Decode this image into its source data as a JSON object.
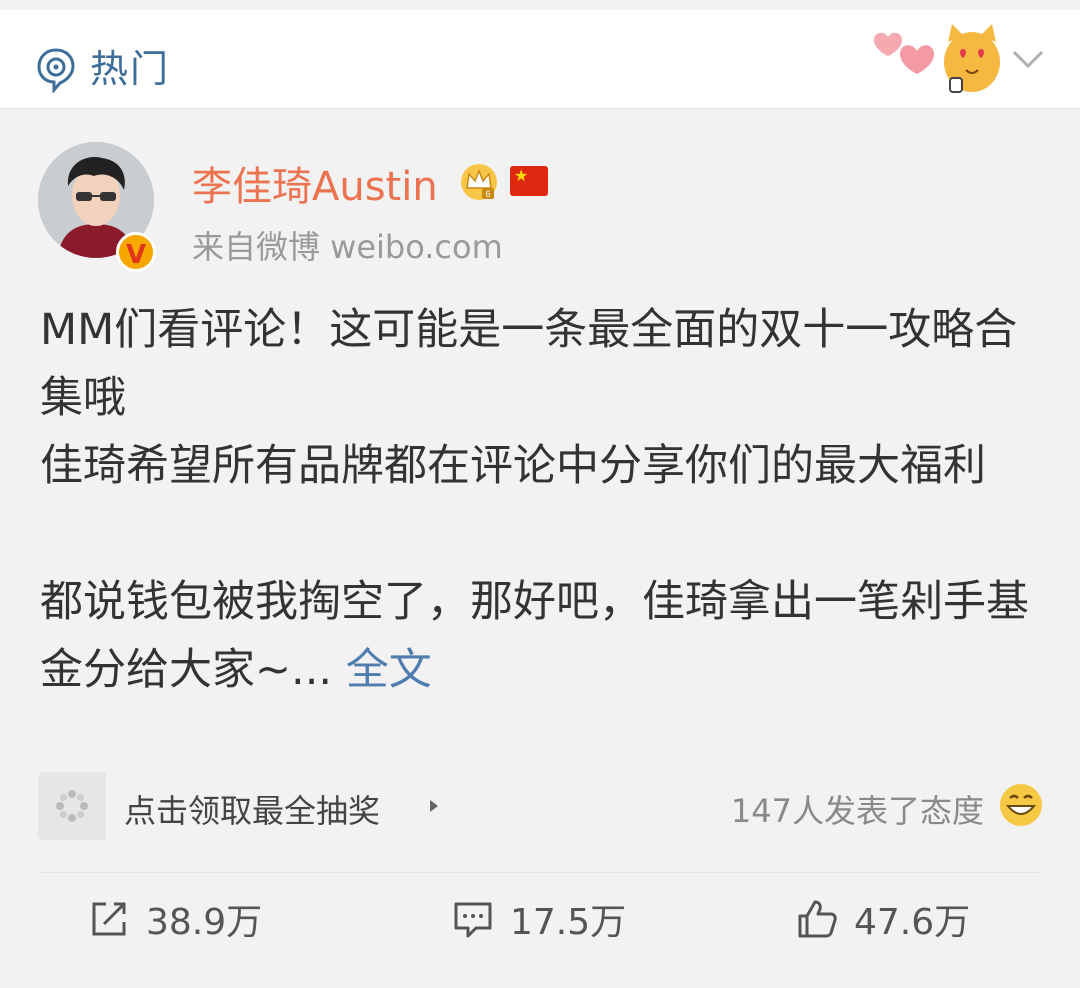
{
  "header": {
    "section_label": "热门"
  },
  "post": {
    "username": "李佳琦Austin",
    "source": "来自微博 weibo.com",
    "verified_badge": "V",
    "body": {
      "line1": "MM们看评论！这可能是一条最全面的双十一攻略合集哦",
      "line2": "佳琦希望所有品牌都在评论中分享你们的最大福利",
      "line3": "都说钱包被我掏空了，那好吧，佳琦拿出一笔剁手基金分给大家~... ",
      "more_link": "全文"
    },
    "lottery_label": "点击领取最全抽奖",
    "attitude_text": "147人发表了态度",
    "actions": {
      "repost_count": "38.9万",
      "comment_count": "17.5万",
      "like_count": "47.6万"
    }
  },
  "colors": {
    "username": "#eb7350",
    "link": "#507daf",
    "header_text": "#3d6d99"
  }
}
